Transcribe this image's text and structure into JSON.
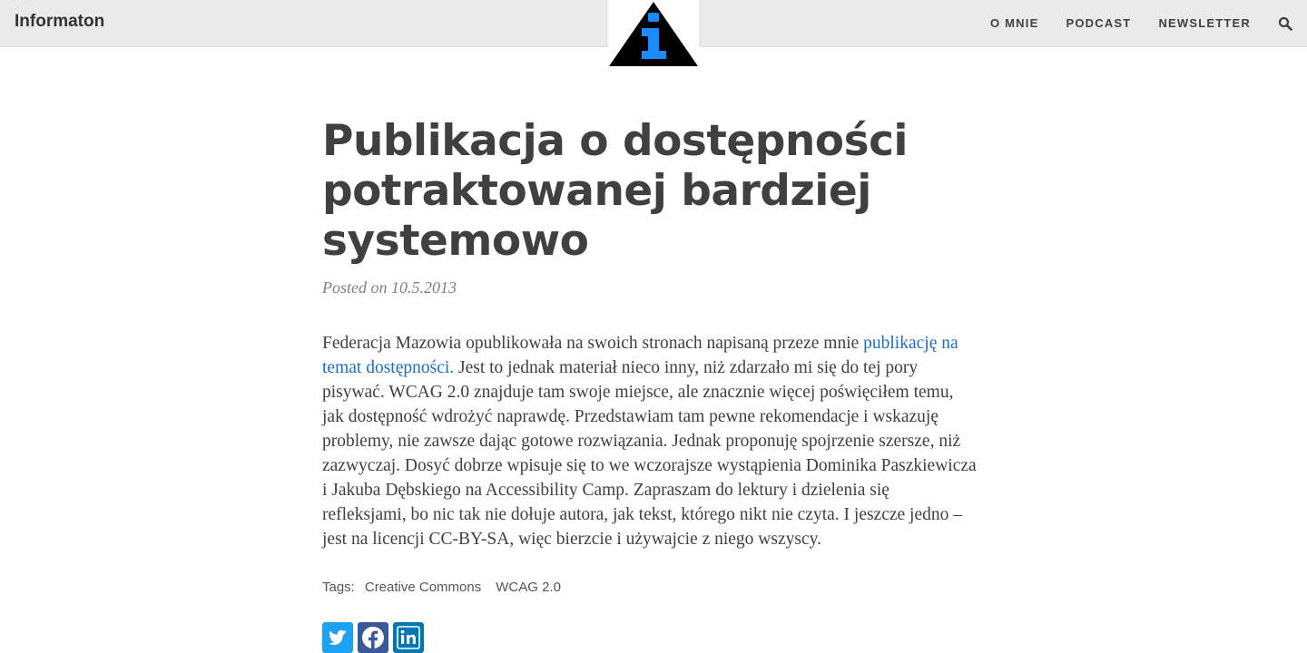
{
  "header": {
    "brand": "Informaton",
    "nav": [
      "O MNIE",
      "PODCAST",
      "NEWSLETTER"
    ],
    "search_icon": "search-icon",
    "logo_icon": "info-triangle-icon"
  },
  "article": {
    "title": "Publikacja o dostępności potraktowanej bardziej systemowo",
    "posted_prefix": "Posted on ",
    "posted_date": "10.5.2013",
    "body_before_link": "Federacja Mazowia opublikowała na swoich stronach napisaną przeze mnie ",
    "link_text": "publikację na temat dostępności.",
    "body_after_link": " Jest to jednak materiał nieco inny, niż zdarzało mi się do tej pory pisywać. WCAG 2.0 znajduje tam swoje miejsce, ale znacznie więcej poświęciłem temu, jak dostępność wdrożyć naprawdę. Przedstawiam tam pewne rekomendacje i wskazuję problemy, nie zawsze dając gotowe rozwiązania. Jednak proponuję spojrzenie szersze, niż zazwyczaj. Dosyć dobrze wpisuje się to we wczorajsze wystąpienia Dominika Paszkiewicza i Jakuba Dębskiego na Accessibility Camp. Zapraszam do lektury i dzielenia się refleksjami, bo nic tak nie dołuje autora, jak tekst, którego nikt nie czyta. I jeszcze jedno – jest na licencji CC-BY-SA, więc bierzcie i używajcie z niego wszyscy.",
    "tags_label": "Tags:",
    "tags": [
      "Creative Commons",
      "WCAG 2.0"
    ]
  },
  "share": {
    "buttons": [
      "twitter-icon",
      "facebook-icon",
      "linkedin-icon"
    ],
    "colors": {
      "twitter": "#1da1f2",
      "facebook": "#3b5998",
      "linkedin": "#0077b5"
    }
  },
  "colors": {
    "link": "#1a6fc0",
    "text": "#404040",
    "header_bg": "#eaeaea",
    "logo_blue": "#1a8cff"
  }
}
